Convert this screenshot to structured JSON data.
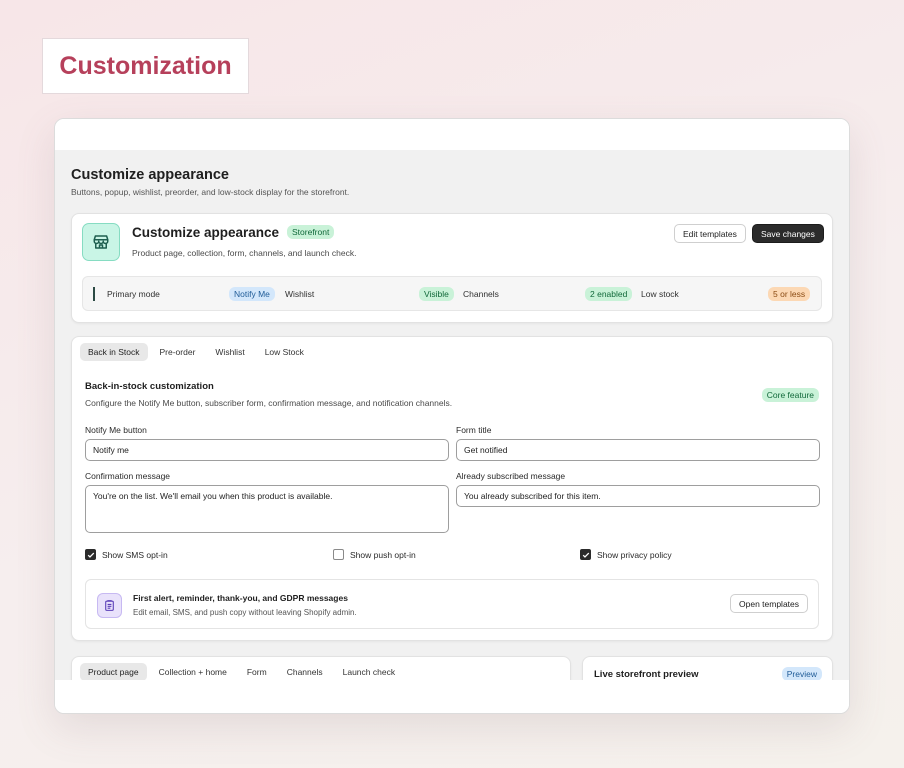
{
  "page": {
    "heading": "Customization"
  },
  "header": {
    "title": "Customize appearance",
    "subtitle": "Buttons, popup, wishlist, preorder, and low-stock display for the storefront."
  },
  "summary": {
    "title": "Customize appearance",
    "badge": "Storefront",
    "subtitle": "Product page, collection, form, channels, and launch check.",
    "edit_templates_label": "Edit templates",
    "save_label": "Save changes",
    "stats": [
      {
        "label": "Primary mode",
        "value": "Notify Me"
      },
      {
        "label": "Wishlist",
        "value": "Visible"
      },
      {
        "label": "Channels",
        "value": "2 enabled"
      },
      {
        "label": "Low stock",
        "value": "5 or less"
      }
    ]
  },
  "tabs": [
    "Back in Stock",
    "Pre-order",
    "Wishlist",
    "Low Stock"
  ],
  "section": {
    "title": "Back-in-stock customization",
    "subtitle": "Configure the Notify Me button, subscriber form, confirmation message, and notification channels.",
    "badge": "Core feature",
    "fields": {
      "notify_label": "Notify Me button",
      "notify_value": "Notify me",
      "form_title_label": "Form title",
      "form_title_value": "Get notified",
      "confirmation_label": "Confirmation message",
      "confirmation_value": "You're on the list. We'll email you when this product is available.",
      "already_label": "Already subscribed message",
      "already_value": "You already subscribed for this item."
    },
    "checks": [
      {
        "label": "Show SMS opt-in",
        "checked": true
      },
      {
        "label": "Show push opt-in",
        "checked": false
      },
      {
        "label": "Show privacy policy",
        "checked": true
      }
    ],
    "templates": {
      "title": "First alert, reminder, thank-you, and GDPR messages",
      "subtitle": "Edit email, SMS, and push copy without leaving Shopify admin.",
      "button_label": "Open templates"
    }
  },
  "bottom_tabs": [
    "Product page",
    "Collection + home",
    "Form",
    "Channels",
    "Launch check"
  ],
  "preview": {
    "title": "Live storefront preview",
    "badge": "Preview"
  },
  "colors": {
    "heading": "#b6405b",
    "accent_green": "#c9f2d8",
    "accent_blue": "#d3e7fb",
    "accent_orange": "#fcd8b4",
    "dark_button": "#2b2b2b"
  }
}
